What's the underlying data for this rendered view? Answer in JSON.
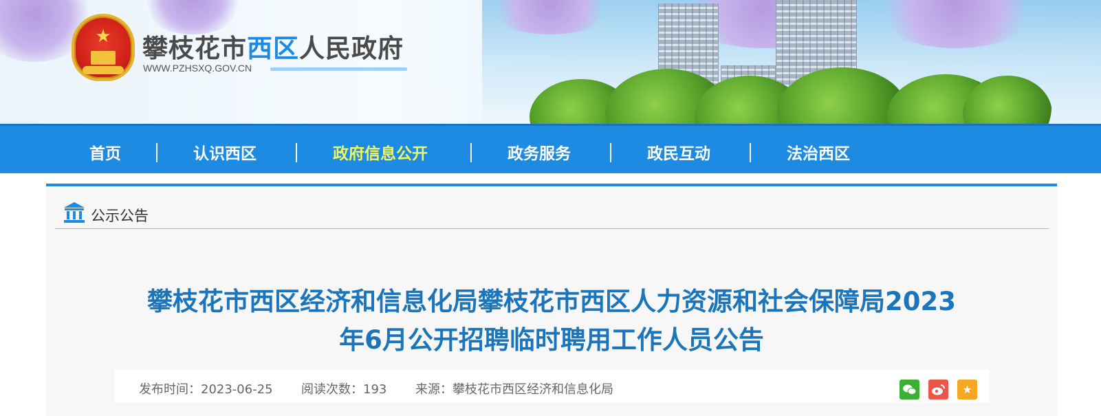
{
  "header": {
    "site_name_part1": "攀枝花市",
    "site_name_part2": "西区",
    "site_name_part3": "人民政府",
    "site_url": "WWW.PZHSXQ.GOV.CN"
  },
  "nav": {
    "items": [
      {
        "label": "首页",
        "active": false
      },
      {
        "label": "认识西区",
        "active": false
      },
      {
        "label": "政府信息公开",
        "active": true
      },
      {
        "label": "政务服务",
        "active": false
      },
      {
        "label": "政民互动",
        "active": false
      },
      {
        "label": "法治西区",
        "active": false
      }
    ],
    "active_color": "#f3f65a",
    "bar_color": "#1e8be2"
  },
  "breadcrumb": {
    "icon": "institution-icon",
    "label": "公示公告"
  },
  "article": {
    "title_line1": "攀枝花市西区经济和信息化局攀枝花市西区人力资源和社会保障局2023",
    "title_line2": "年6月公开招聘临时聘用工作人员公告",
    "title_color": "#1b75bb",
    "publish_label": "发布时间：2023-06-25",
    "views_label": "阅读次数：193",
    "source_label": "来源：攀枝花市西区经济和信息化局"
  },
  "share": {
    "icons": [
      "wechat-icon",
      "weibo-icon",
      "favorite-star-icon"
    ]
  }
}
